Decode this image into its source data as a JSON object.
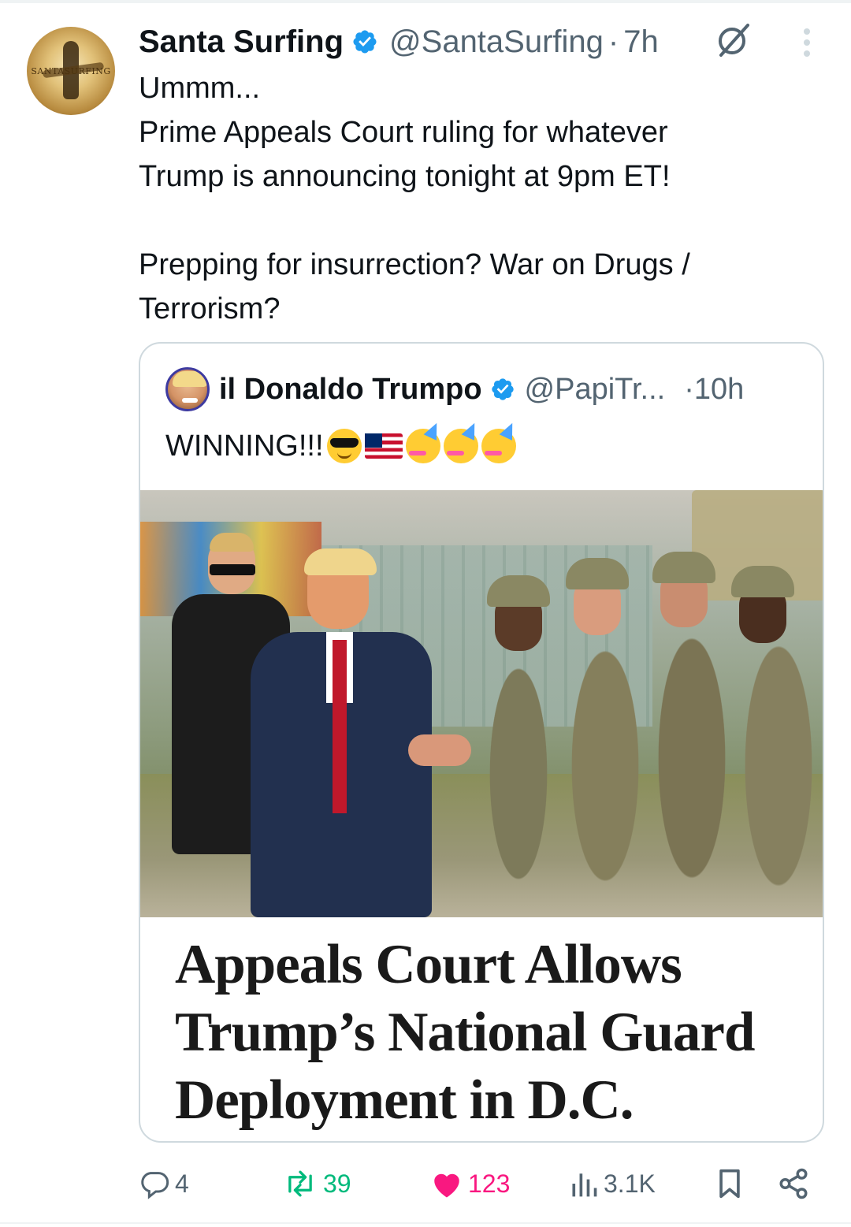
{
  "tweet": {
    "display_name": "Santa Surfing",
    "handle": "@SantaSurfing",
    "separator": "·",
    "time": "7h",
    "avatar_text": "SANTASURFING",
    "text": "Ummm...\nPrime Appeals Court ruling for whatever\nTrump is announcing tonight at 9pm ET!\n\nPrepping for insurrection?  War on Drugs /\nTerrorism?"
  },
  "quote": {
    "display_name": "il Donaldo Trumpo",
    "handle": "@PapiTr...",
    "separator": "·",
    "time": "10h",
    "text": "WINNING!!!",
    "emojis": [
      "smiling-face-with-sunglasses",
      "us-flag",
      "partying-face",
      "partying-face",
      "partying-face"
    ],
    "headline": "Appeals Court Allows\nTrump’s National Guard\nDeployment in D.C."
  },
  "actions": {
    "replies": "4",
    "reposts": "39",
    "likes": "123",
    "views": "3.1K"
  },
  "colors": {
    "verified": "#1d9bf0",
    "repost_active": "#00ba7c",
    "like_active": "#f91880",
    "muted_text": "#536471"
  }
}
